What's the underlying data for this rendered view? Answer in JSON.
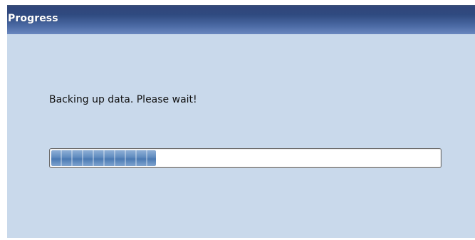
{
  "window": {
    "title": "Progress"
  },
  "dialog": {
    "message": "Backing up data. Please wait!"
  },
  "progress": {
    "fraction": 0.27
  },
  "colors": {
    "title_bar": "#34508a",
    "dialog_background": "#c9d9eb",
    "progress_fill": "#5f8bbf"
  }
}
